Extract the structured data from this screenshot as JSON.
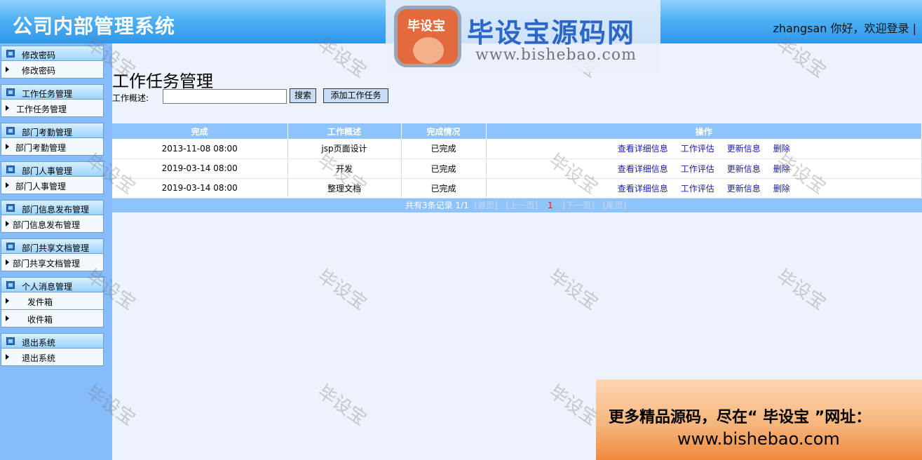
{
  "header": {
    "title": "公司内部管理系统",
    "welcome": "zhangsan 你好，欢迎登录 |"
  },
  "sidebar": {
    "groups": [
      {
        "title": "修改密码",
        "items": [
          "修改密码"
        ]
      },
      {
        "title": "工作任务管理",
        "items": [
          "工作任务管理"
        ]
      },
      {
        "title": "部门考勤管理",
        "items": [
          "部门考勤管理"
        ]
      },
      {
        "title": "部门人事管理",
        "items": [
          "部门人事管理"
        ]
      },
      {
        "title": "部门信息发布管理",
        "items": [
          "部门信息发布管理"
        ]
      },
      {
        "title": "部门共享文档管理",
        "items": [
          "部门共享文档管理"
        ]
      },
      {
        "title": "个人消息管理",
        "items": [
          "发件箱",
          "收件箱"
        ]
      },
      {
        "title": "退出系统",
        "items": [
          "退出系统"
        ]
      }
    ]
  },
  "main": {
    "page_title": "工作任务管理",
    "search_label": "工作概述:",
    "search_value": "",
    "search_button": "搜索",
    "add_button": "添加工作任务",
    "table": {
      "headers": [
        "完成",
        "工作概述",
        "完成情况",
        "操作"
      ],
      "rows": [
        {
          "date": "2013-11-08 08:00",
          "summary": "jsp页面设计",
          "status": "已完成"
        },
        {
          "date": "2019-03-14 08:00",
          "summary": "开发",
          "status": "已完成"
        },
        {
          "date": "2019-03-14 08:00",
          "summary": "整理文档",
          "status": "已完成"
        }
      ],
      "actions": [
        "查看详细信息",
        "工作评估",
        "更新信息",
        "删除"
      ]
    },
    "pager": {
      "summary": "共有3条记录  1/1",
      "first": "[首页]",
      "prev": "[上一页]",
      "current": "1",
      "next": "[下一页]",
      "last": "[尾页]"
    }
  },
  "overlay": {
    "watermark": "毕设宝",
    "logo_badge": "毕设宝",
    "logo_brand": "毕设宝源码网",
    "logo_url": "www.bishebao.com",
    "promo_line1": "更多精品源码，尽在“ 毕设宝 ”网址：",
    "promo_line2": "www.bishebao.com"
  }
}
